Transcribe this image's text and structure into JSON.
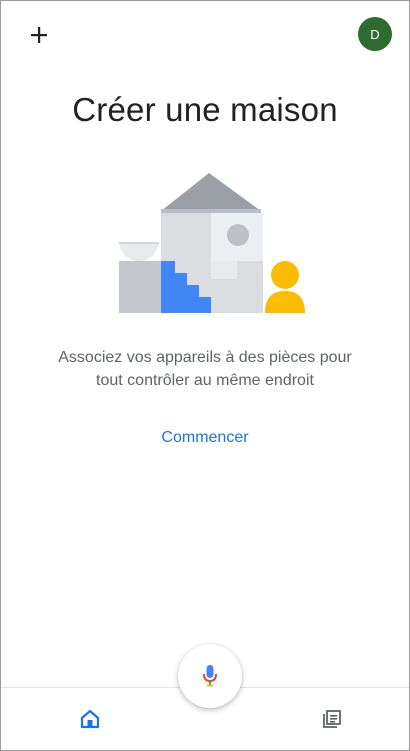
{
  "header": {
    "add_icon": "plus-icon",
    "avatar_initial": "D",
    "avatar_color": "#2e6b2e"
  },
  "main": {
    "title": "Créer une maison",
    "illustration_icon": "house-illustration",
    "description_line1": "Associez vos appareils à des pièces pour",
    "description_line2": "tout contrôler au même endroit",
    "start_label": "Commencer",
    "accent_color": "#1a73e8"
  },
  "bottom_nav": {
    "home_icon": "home-icon",
    "mic_icon": "microphone-icon",
    "feed_icon": "feed-icon",
    "active_tab": "home"
  }
}
